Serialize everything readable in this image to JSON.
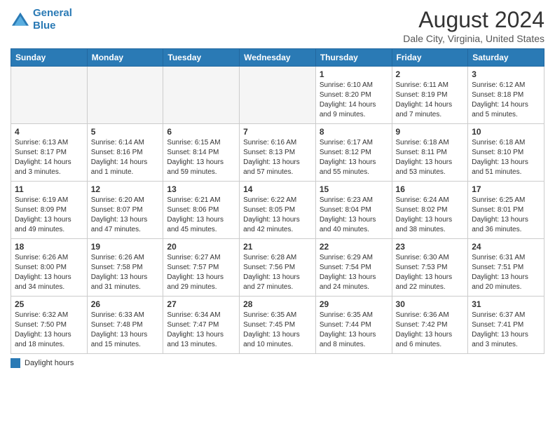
{
  "header": {
    "logo_line1": "General",
    "logo_line2": "Blue",
    "month": "August 2024",
    "location": "Dale City, Virginia, United States"
  },
  "days": [
    "Sunday",
    "Monday",
    "Tuesday",
    "Wednesday",
    "Thursday",
    "Friday",
    "Saturday"
  ],
  "weeks": [
    [
      {
        "date": "",
        "info": ""
      },
      {
        "date": "",
        "info": ""
      },
      {
        "date": "",
        "info": ""
      },
      {
        "date": "",
        "info": ""
      },
      {
        "date": "1",
        "info": "Sunrise: 6:10 AM\nSunset: 8:20 PM\nDaylight: 14 hours\nand 9 minutes."
      },
      {
        "date": "2",
        "info": "Sunrise: 6:11 AM\nSunset: 8:19 PM\nDaylight: 14 hours\nand 7 minutes."
      },
      {
        "date": "3",
        "info": "Sunrise: 6:12 AM\nSunset: 8:18 PM\nDaylight: 14 hours\nand 5 minutes."
      }
    ],
    [
      {
        "date": "4",
        "info": "Sunrise: 6:13 AM\nSunset: 8:17 PM\nDaylight: 14 hours\nand 3 minutes."
      },
      {
        "date": "5",
        "info": "Sunrise: 6:14 AM\nSunset: 8:16 PM\nDaylight: 14 hours\nand 1 minute."
      },
      {
        "date": "6",
        "info": "Sunrise: 6:15 AM\nSunset: 8:14 PM\nDaylight: 13 hours\nand 59 minutes."
      },
      {
        "date": "7",
        "info": "Sunrise: 6:16 AM\nSunset: 8:13 PM\nDaylight: 13 hours\nand 57 minutes."
      },
      {
        "date": "8",
        "info": "Sunrise: 6:17 AM\nSunset: 8:12 PM\nDaylight: 13 hours\nand 55 minutes."
      },
      {
        "date": "9",
        "info": "Sunrise: 6:18 AM\nSunset: 8:11 PM\nDaylight: 13 hours\nand 53 minutes."
      },
      {
        "date": "10",
        "info": "Sunrise: 6:18 AM\nSunset: 8:10 PM\nDaylight: 13 hours\nand 51 minutes."
      }
    ],
    [
      {
        "date": "11",
        "info": "Sunrise: 6:19 AM\nSunset: 8:09 PM\nDaylight: 13 hours\nand 49 minutes."
      },
      {
        "date": "12",
        "info": "Sunrise: 6:20 AM\nSunset: 8:07 PM\nDaylight: 13 hours\nand 47 minutes."
      },
      {
        "date": "13",
        "info": "Sunrise: 6:21 AM\nSunset: 8:06 PM\nDaylight: 13 hours\nand 45 minutes."
      },
      {
        "date": "14",
        "info": "Sunrise: 6:22 AM\nSunset: 8:05 PM\nDaylight: 13 hours\nand 42 minutes."
      },
      {
        "date": "15",
        "info": "Sunrise: 6:23 AM\nSunset: 8:04 PM\nDaylight: 13 hours\nand 40 minutes."
      },
      {
        "date": "16",
        "info": "Sunrise: 6:24 AM\nSunset: 8:02 PM\nDaylight: 13 hours\nand 38 minutes."
      },
      {
        "date": "17",
        "info": "Sunrise: 6:25 AM\nSunset: 8:01 PM\nDaylight: 13 hours\nand 36 minutes."
      }
    ],
    [
      {
        "date": "18",
        "info": "Sunrise: 6:26 AM\nSunset: 8:00 PM\nDaylight: 13 hours\nand 34 minutes."
      },
      {
        "date": "19",
        "info": "Sunrise: 6:26 AM\nSunset: 7:58 PM\nDaylight: 13 hours\nand 31 minutes."
      },
      {
        "date": "20",
        "info": "Sunrise: 6:27 AM\nSunset: 7:57 PM\nDaylight: 13 hours\nand 29 minutes."
      },
      {
        "date": "21",
        "info": "Sunrise: 6:28 AM\nSunset: 7:56 PM\nDaylight: 13 hours\nand 27 minutes."
      },
      {
        "date": "22",
        "info": "Sunrise: 6:29 AM\nSunset: 7:54 PM\nDaylight: 13 hours\nand 24 minutes."
      },
      {
        "date": "23",
        "info": "Sunrise: 6:30 AM\nSunset: 7:53 PM\nDaylight: 13 hours\nand 22 minutes."
      },
      {
        "date": "24",
        "info": "Sunrise: 6:31 AM\nSunset: 7:51 PM\nDaylight: 13 hours\nand 20 minutes."
      }
    ],
    [
      {
        "date": "25",
        "info": "Sunrise: 6:32 AM\nSunset: 7:50 PM\nDaylight: 13 hours\nand 18 minutes."
      },
      {
        "date": "26",
        "info": "Sunrise: 6:33 AM\nSunset: 7:48 PM\nDaylight: 13 hours\nand 15 minutes."
      },
      {
        "date": "27",
        "info": "Sunrise: 6:34 AM\nSunset: 7:47 PM\nDaylight: 13 hours\nand 13 minutes."
      },
      {
        "date": "28",
        "info": "Sunrise: 6:35 AM\nSunset: 7:45 PM\nDaylight: 13 hours\nand 10 minutes."
      },
      {
        "date": "29",
        "info": "Sunrise: 6:35 AM\nSunset: 7:44 PM\nDaylight: 13 hours\nand 8 minutes."
      },
      {
        "date": "30",
        "info": "Sunrise: 6:36 AM\nSunset: 7:42 PM\nDaylight: 13 hours\nand 6 minutes."
      },
      {
        "date": "31",
        "info": "Sunrise: 6:37 AM\nSunset: 7:41 PM\nDaylight: 13 hours\nand 3 minutes."
      }
    ]
  ],
  "legend": {
    "label": "Daylight hours"
  }
}
